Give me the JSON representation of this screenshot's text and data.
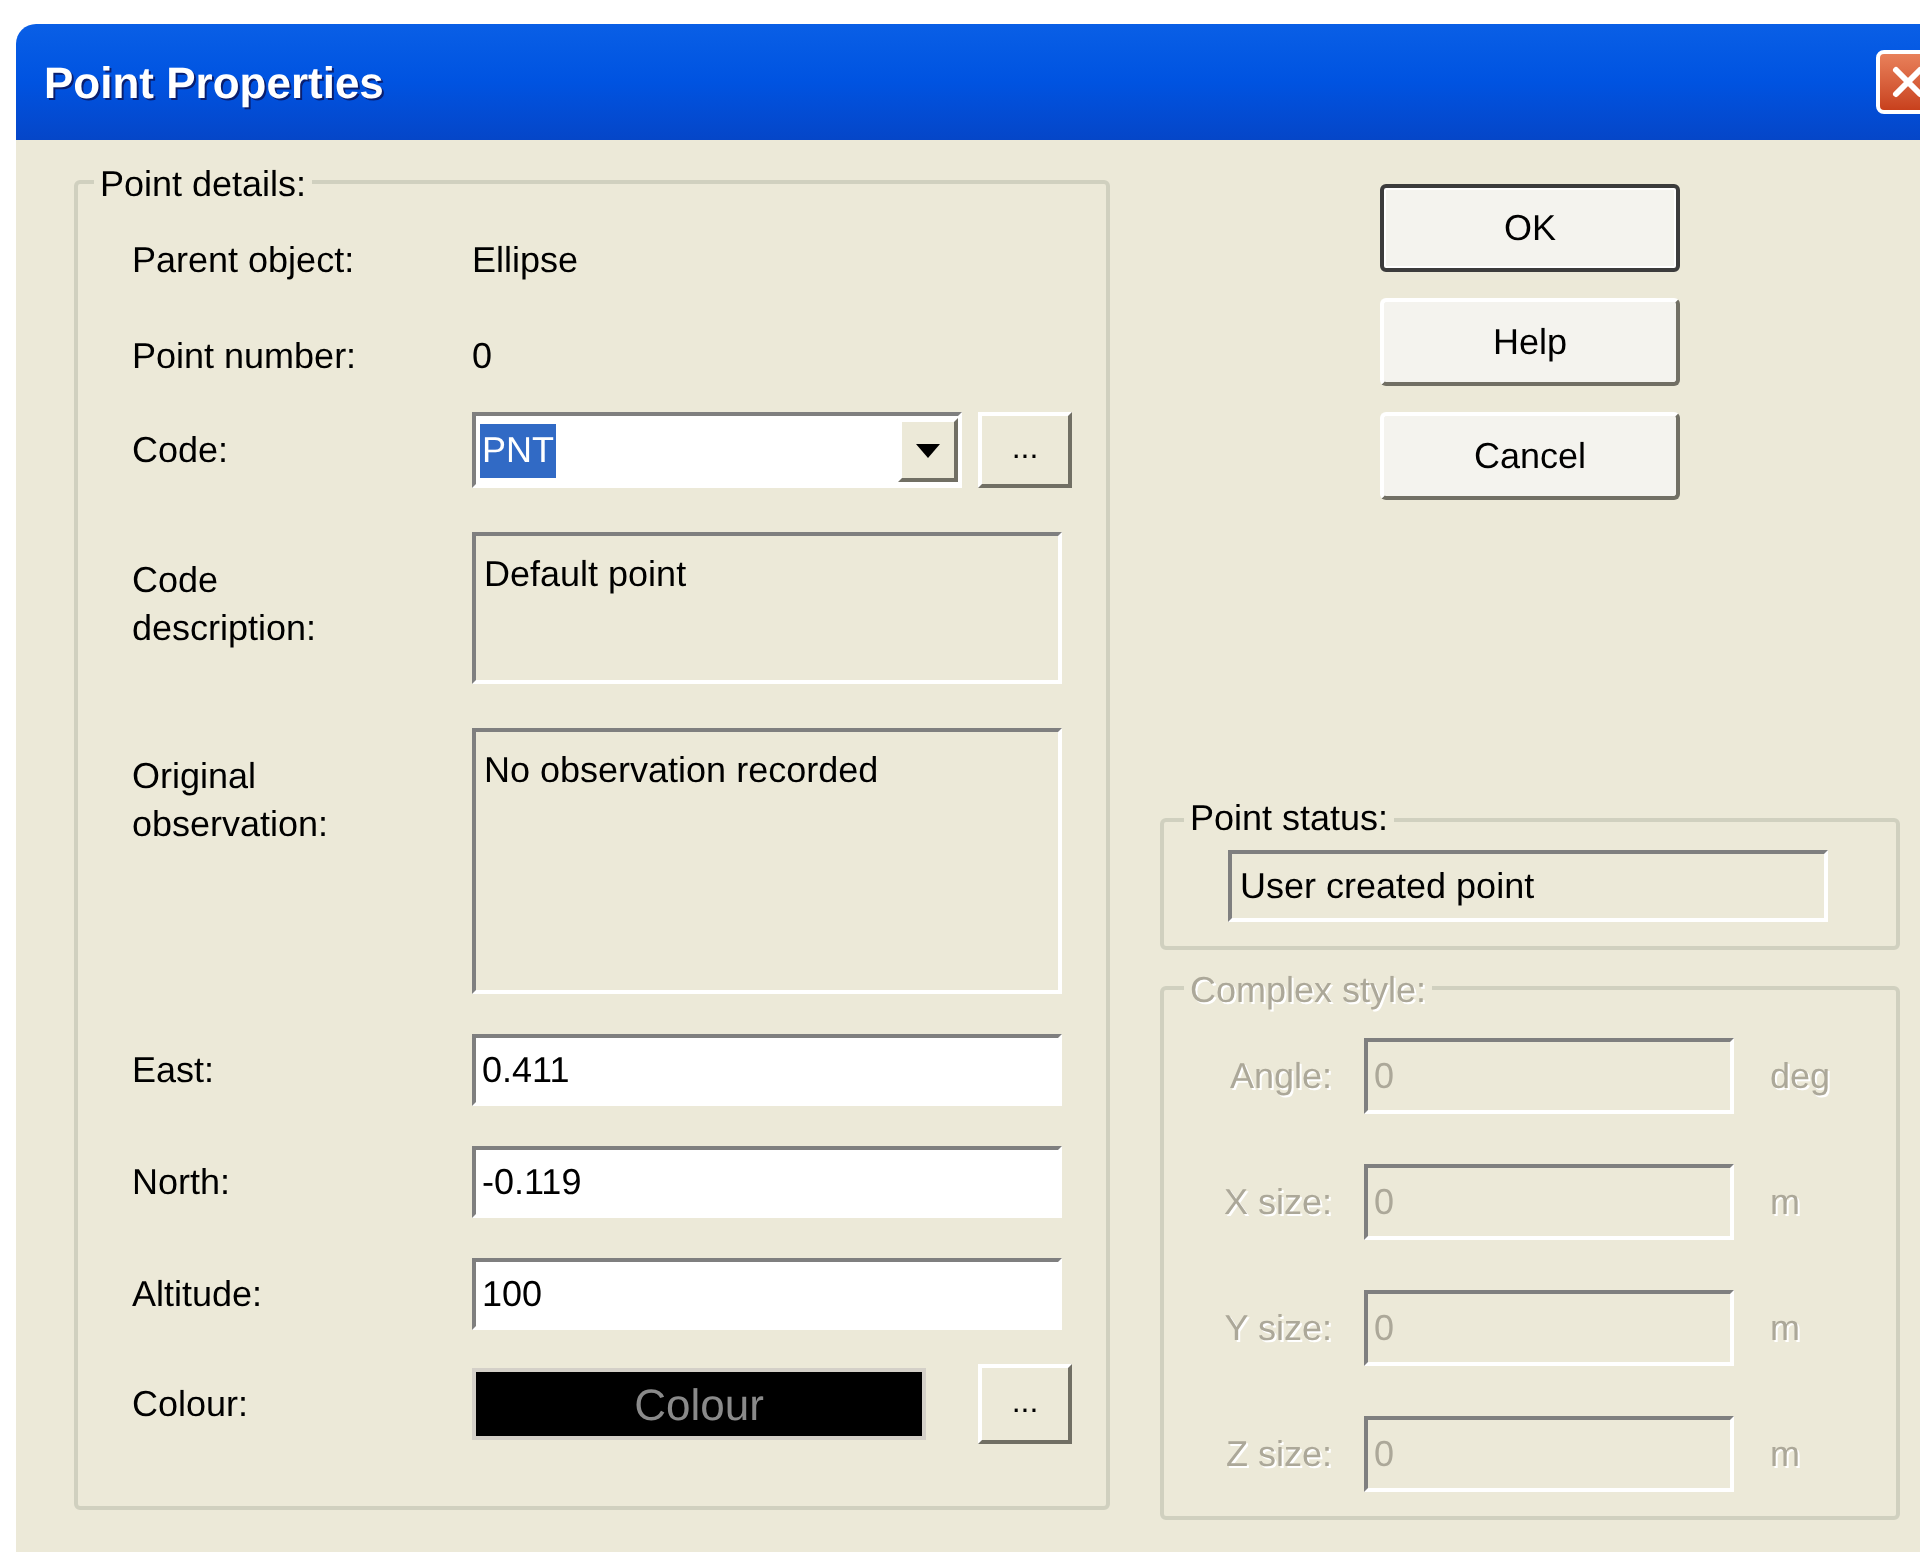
{
  "window": {
    "title": "Point Properties"
  },
  "point_details": {
    "legend": "Point details:",
    "rows": [
      {
        "kind": "static",
        "label": "Parent object:",
        "value": "Ellipse"
      },
      {
        "kind": "static",
        "label": "Point number:",
        "value": "0"
      },
      {
        "kind": "combo",
        "label": "Code:",
        "value": "PNT",
        "text_selected": true,
        "browse": "..."
      },
      {
        "kind": "memo",
        "label": "Code description:",
        "value": "Default point"
      },
      {
        "kind": "longmemo",
        "label": "Original observation:",
        "value": "No observation recorded"
      },
      {
        "kind": "edit",
        "label": "East:",
        "value": "0.411"
      },
      {
        "kind": "edit",
        "label": "North:",
        "value": "-0.119"
      },
      {
        "kind": "edit",
        "label": "Altitude:",
        "value": "100"
      },
      {
        "kind": "colour",
        "label": "Colour:",
        "value": "Colour",
        "color": "#000000",
        "browse": "..."
      }
    ]
  },
  "buttons": [
    {
      "label": "OK",
      "default": true
    },
    {
      "label": "Help",
      "default": false
    },
    {
      "label": "Cancel",
      "default": false
    }
  ],
  "point_status": {
    "legend": "Point status:",
    "value": "User created point"
  },
  "complex_style": {
    "legend": "Complex style:",
    "disabled": true,
    "rows": [
      {
        "label": "Angle:",
        "value": "0",
        "unit": "deg"
      },
      {
        "label": "X size:",
        "value": "0",
        "unit": "m"
      },
      {
        "label": "Y size:",
        "value": "0",
        "unit": "m"
      },
      {
        "label": "Z size:",
        "value": "0",
        "unit": "m"
      }
    ]
  }
}
